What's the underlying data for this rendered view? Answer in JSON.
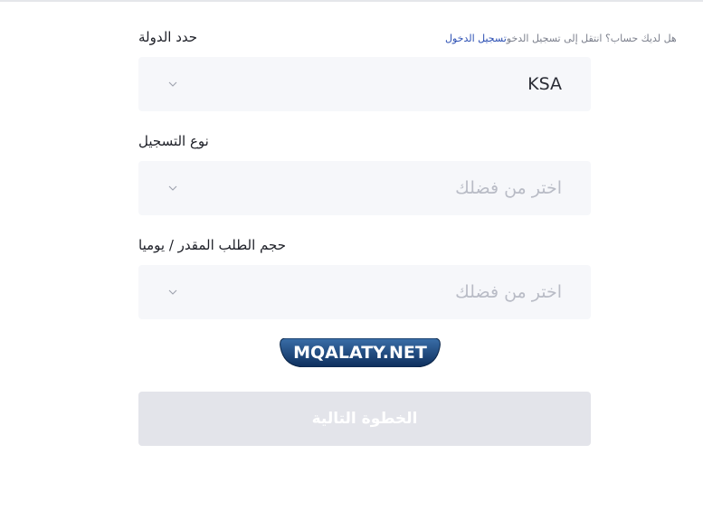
{
  "login_hint": {
    "text": "هل لديك حساب؟ انتقل إلى تسجيل الدخو",
    "link": "تسجيل الدخول"
  },
  "fields": [
    {
      "label": "حدد الدولة",
      "value": "KSA",
      "is_placeholder": false
    },
    {
      "label": "نوع التسجيل",
      "value": "اختر من فضلك",
      "is_placeholder": true
    },
    {
      "label": "حجم الطلب المقدر / يوميا",
      "value": "اختر من فضلك",
      "is_placeholder": true
    }
  ],
  "watermark": "MQALATY.NET",
  "next_button": "الخطوة التالية",
  "colors": {
    "link": "#2b4fb3",
    "field_bg": "#f6f7fa",
    "button_bg": "#e3e4ea",
    "placeholder": "#b9bcc6"
  }
}
